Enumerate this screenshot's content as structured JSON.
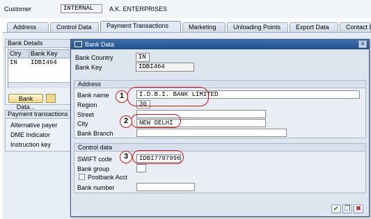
{
  "header": {
    "customer_label": "Customer",
    "customer_id": "INTERNAL",
    "customer_name": "A.K. ENTERPRISES"
  },
  "tabs": [
    {
      "label": "Address"
    },
    {
      "label": "Control Data"
    },
    {
      "label": "Payment Transactions"
    },
    {
      "label": "Marketing"
    },
    {
      "label": "Unloading Points"
    },
    {
      "label": "Export Data"
    },
    {
      "label": "Contact P"
    }
  ],
  "bank_details": {
    "title": "Bank Details",
    "columns": [
      "Ctry",
      "Bank Key"
    ],
    "rows": [
      {
        "ctry": "IN",
        "bank_key": "IDBI464"
      }
    ],
    "bank_data_button": "Bank Data..."
  },
  "payment_transactions": {
    "title": "Payment transactions",
    "fields": [
      "Alternative payer",
      "DME Indicator",
      "Instruction key"
    ]
  },
  "dialog": {
    "title": "Bank Data",
    "bank_country_label": "Bank Country",
    "bank_country": "IN",
    "bank_key_label": "Bank Key",
    "bank_key": "IDBI464",
    "address_section": "Address",
    "bank_name_label": "Bank name",
    "bank_name": "I.D.B.I. BANK LIMITED",
    "region_label": "Region",
    "region": "30",
    "street_label": "Street",
    "street": "",
    "city_label": "City",
    "city": "NEW DELHI",
    "branch_label": "Bank Branch",
    "branch": "",
    "control_section": "Control data",
    "swift_label": "SWIFT code",
    "swift": "IDBI7797996",
    "bank_group_label": "Bank group",
    "bank_group": "",
    "postbank_label": "Postbank Acct",
    "bank_number_label": "Bank number",
    "bank_number": ""
  },
  "annotations": [
    "1",
    "2",
    "3"
  ],
  "icons": {
    "dialog_icon": "window-icon",
    "close": "close-icon",
    "confirm": "check-icon",
    "copy": "copy-icon",
    "cancel": "cancel-icon"
  },
  "colors": {
    "title_bar": "#1f4f8e",
    "annotation": "#d81414",
    "confirm": "#2e8b1e",
    "cancel": "#c01818"
  }
}
